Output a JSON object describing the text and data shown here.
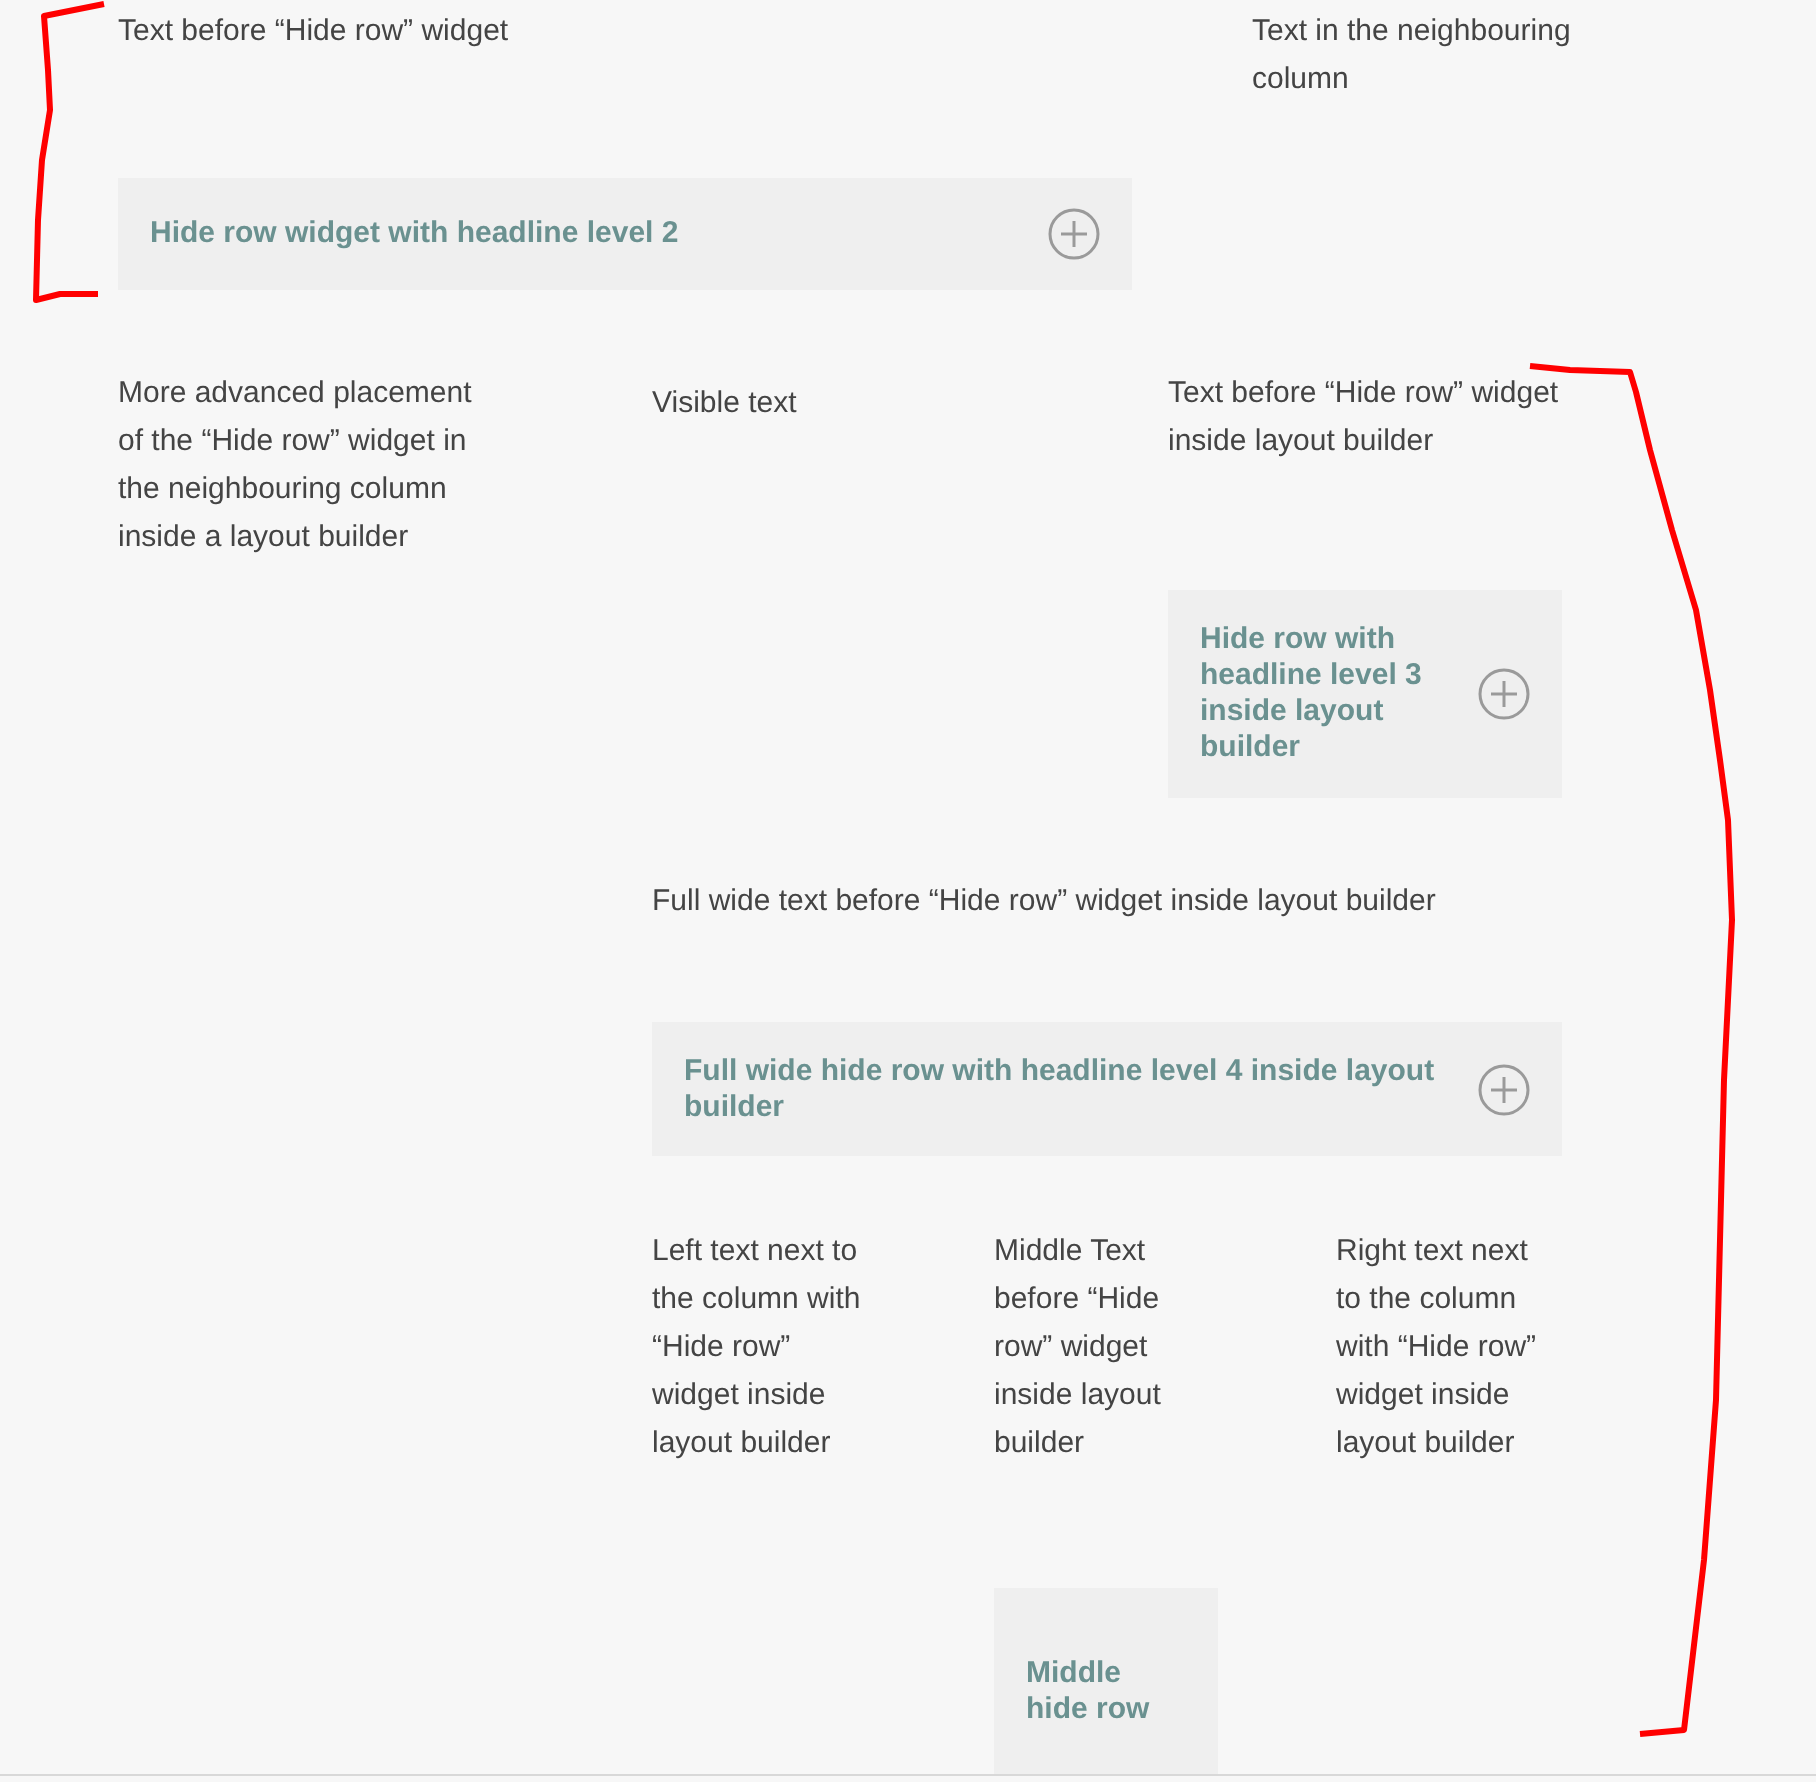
{
  "top": {
    "text": "Text before “Hide row” widget",
    "accordion": {
      "headline": "Hide row widget with headline level 2",
      "expanded": false
    },
    "side_text": "Text in the neighbouring column"
  },
  "layout": {
    "side_text": "More advanced placement of the “Hide row” widget in the neighbouring column inside a layout builder",
    "visible_text": "Visible text",
    "column_text": "Text before “Hide row” widget inside layout builder",
    "column_accordion": {
      "headline": "Hide row with headline level 3 inside layout builder",
      "expanded": false
    },
    "full_text": "Full wide text before “Hide row” widget inside layout builder",
    "full_accordion": {
      "headline": "Full wide hide row with headline level 4 inside layout builder",
      "expanded": false
    },
    "three_columns": [
      {
        "text": "Left text next to the column with “Hide row” widget inside layout builder"
      },
      {
        "text": "Middle Text before “Hide row” widget inside layout builder",
        "accordion": {
          "headline": "Middle hide row"
        }
      },
      {
        "text": "Right text next to the column with “Hide row” widget inside layout builder"
      }
    ]
  }
}
